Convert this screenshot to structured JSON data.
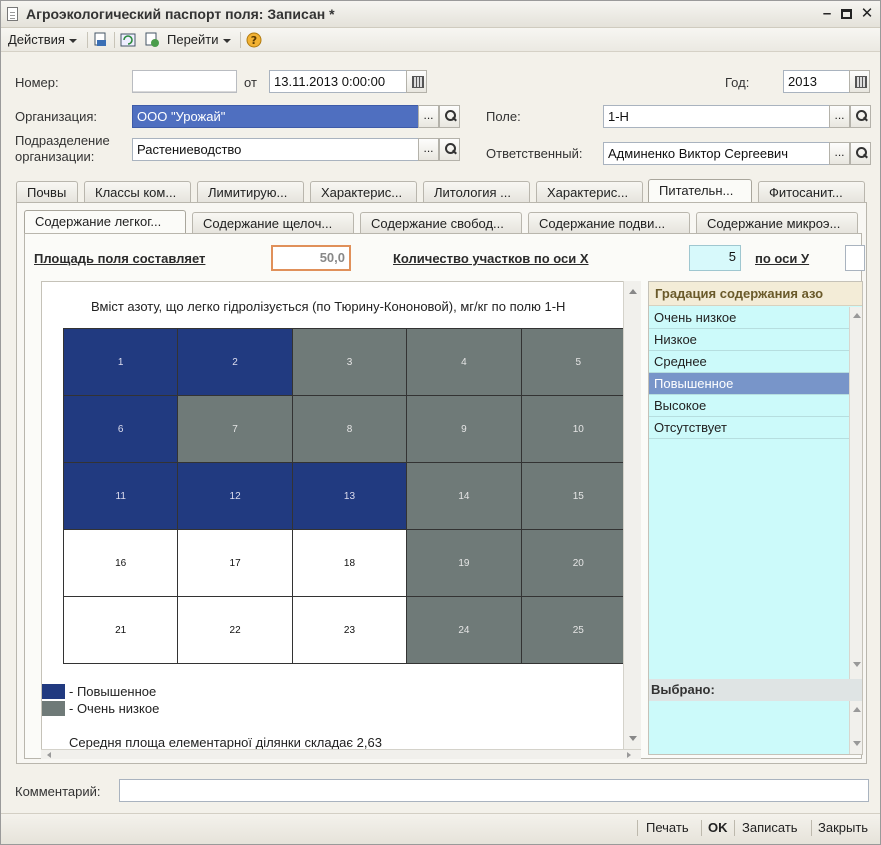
{
  "window": {
    "title": "Агроэкологический паспорт поля: Записан *"
  },
  "toolbar": {
    "actions": "Действия",
    "goto": "Перейти"
  },
  "form": {
    "number_label": "Номер:",
    "number_value": "",
    "date_label": "от",
    "date_value": "13.11.2013  0:00:00",
    "year_label": "Год:",
    "year_value": "2013",
    "org_label": "Организация:",
    "org_value": "ООО \"Урожай\"",
    "field_label": "Поле:",
    "field_value": "1-Н",
    "subdiv_label_1": "Подразделение",
    "subdiv_label_2": "организации:",
    "subdiv_value": "Растениеводство",
    "resp_label": "Ответственный:",
    "resp_value": "Админенко Виктор Сергеевич",
    "dots": "..."
  },
  "tabs": [
    "Почвы",
    "Классы ком...",
    "Лимитирую...",
    "Характерис...",
    "Литология ...",
    "Характерис...",
    "Питательн...",
    "Фитосанит..."
  ],
  "subtabs": [
    "Содержание легког...",
    "Содержание щелоч...",
    "Содержание свобод...",
    "Содержание подви...",
    "Содержание микроэ..."
  ],
  "params": {
    "area_label": "Площадь поля составляет",
    "area_value": "50,0",
    "count_x_label": "Количество участков по оси Х",
    "count_x_value": "5",
    "axis_y_label": "по оси У"
  },
  "report": {
    "title": "Вміст азоту, що легко гідролізується (по Тюрину-Кононовой), мг/кг по полю 1-Н",
    "cells": [
      {
        "n": "1",
        "g": "high"
      },
      {
        "n": "2",
        "g": "high"
      },
      {
        "n": "3",
        "g": "vlow"
      },
      {
        "n": "4",
        "g": "vlow"
      },
      {
        "n": "5",
        "g": "vlow"
      },
      {
        "n": "6",
        "g": "high"
      },
      {
        "n": "7",
        "g": "vlow"
      },
      {
        "n": "8",
        "g": "vlow"
      },
      {
        "n": "9",
        "g": "vlow"
      },
      {
        "n": "10",
        "g": "vlow"
      },
      {
        "n": "11",
        "g": "high"
      },
      {
        "n": "12",
        "g": "high"
      },
      {
        "n": "13",
        "g": "high"
      },
      {
        "n": "14",
        "g": "vlow"
      },
      {
        "n": "15",
        "g": "vlow"
      },
      {
        "n": "16",
        "g": "abs"
      },
      {
        "n": "17",
        "g": "abs"
      },
      {
        "n": "18",
        "g": "abs"
      },
      {
        "n": "19",
        "g": "vlow"
      },
      {
        "n": "20",
        "g": "vlow"
      },
      {
        "n": "21",
        "g": "abs"
      },
      {
        "n": "22",
        "g": "abs"
      },
      {
        "n": "23",
        "g": "abs"
      },
      {
        "n": "24",
        "g": "vlow"
      },
      {
        "n": "25",
        "g": "vlow"
      }
    ],
    "legend": [
      {
        "label": "- Повышенное",
        "color": "#213a80"
      },
      {
        "label": "- Очень низкое",
        "color": "#6f7a78"
      }
    ],
    "footer": "Середня площа елементарної ділянки складає 2,63"
  },
  "colors": {
    "high": "#213a80",
    "vlow": "#6f7a78",
    "abs": "#ffffff",
    "list_bg": "#ccfafa",
    "list_sel": "#7895c9"
  },
  "gradation": {
    "header": "Градация содержания азо",
    "items": [
      "Очень низкое",
      "Низкое",
      "Среднее",
      "Повышенное",
      "Высокое",
      "Отсутствует"
    ],
    "selected_index": 3,
    "selected_label": "Выбрано:"
  },
  "comment": {
    "label": "Комментарий:",
    "value": ""
  },
  "bottom": {
    "print": "Печать",
    "ok": "OK",
    "save": "Записать",
    "close": "Закрыть"
  }
}
